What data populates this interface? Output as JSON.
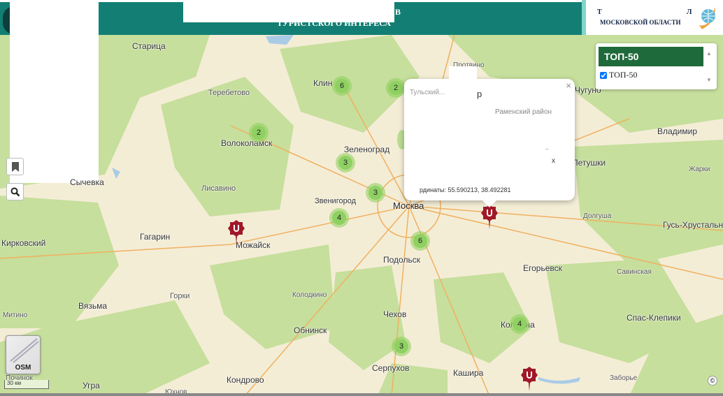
{
  "header": {
    "title_line1_fragment": "В",
    "title_line2": "ТУРИСТСКОГО ИНТЕРЕСА",
    "right_logo_top_left": "Т",
    "right_logo_top_right": "Л",
    "right_logo_bottom": "МОСКОВСКОЙ ОБЛАСТИ"
  },
  "colors": {
    "header": "#137f74",
    "layer_header": "#1f6a3a",
    "marker": "#a01828",
    "cluster": "#8fd062"
  },
  "layers": {
    "title": "ТОП-50",
    "items": [
      {
        "label": "ТОП-50",
        "checked": true
      }
    ]
  },
  "popup": {
    "close": "×",
    "frag_title_left": "Тульский...",
    "frag_title_right": "р",
    "frag_district": "Раменский район",
    "frag_mid": "..",
    "frag_x": "x",
    "frag_coords": "рдинаты: 55.590213, 38.492281"
  },
  "controls": {
    "bookmark": "bookmark-icon",
    "search": "search-icon"
  },
  "basemap": {
    "label": "OSM"
  },
  "scale": "30 км",
  "copyright": "©",
  "cities": [
    "Старица",
    "Теребетово",
    "Клин",
    "Протвино",
    "Волоколамск",
    "Зеленоград",
    "Сычевка",
    "Лисавино",
    "Звенигород",
    "Москва",
    "Гагарин",
    "Можайск",
    "Кирковский",
    "Подольск",
    "Вязьма",
    "Горки",
    "Колодкино",
    "Митино",
    "Обнинск",
    "Чехов",
    "Серпухов",
    "Кашира",
    "Коломна",
    "Угра",
    "Кондрово",
    "Юхнов",
    "Владимир",
    "Петушки",
    "Жарки",
    "Долгуша",
    "Гусь-Хрустальный",
    "Егорьевск",
    "Савинская",
    "Спас-Клепики",
    "Заборье",
    "Чугуно",
    "Починок"
  ],
  "clusters": [
    6,
    2,
    2,
    3,
    3,
    4,
    6,
    4,
    3
  ]
}
